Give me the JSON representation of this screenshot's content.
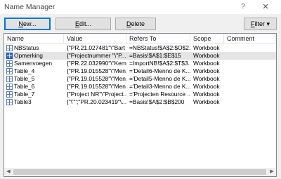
{
  "window": {
    "title": "Name Manager",
    "help_glyph": "?",
    "close_glyph": "✕"
  },
  "toolbar": {
    "new": {
      "mnemonic": "N",
      "rest": "ew..."
    },
    "edit": {
      "mnemonic": "E",
      "rest": "dit..."
    },
    "delete": {
      "mnemonic": "D",
      "rest": "elete"
    },
    "filter": {
      "mnemonic": "F",
      "rest": "ilter",
      "arrow": "▾"
    }
  },
  "table": {
    "columns": {
      "name": "Name",
      "value": "Value",
      "refers_to": "Refers To",
      "scope": "Scope",
      "comment": "Comment"
    },
    "rows": [
      {
        "name": "NBStatus",
        "value": "{\"PR.21.027481\"\\\"Bart ...",
        "refers_to": "=NBStatus!$A$2:$O$2...",
        "scope": "Workbook",
        "comment": ""
      },
      {
        "name": "Opmerking",
        "value": "{\"Projectnummer \"\\\"P...",
        "refers_to": "=Basis!$A$1:$E$15",
        "scope": "Workbook",
        "comment": ""
      },
      {
        "name": "Samenvoegen",
        "value": "{\"PR.22.032990\"\\\"Kem...",
        "refers_to": "=ImportNB!$A$2:$T$3...",
        "scope": "Workbook",
        "comment": ""
      },
      {
        "name": "Table_4",
        "value": "{\"PR.19.015528\"\\\"Men...",
        "refers_to": "='Detail6-Menno de K...",
        "scope": "Workbook",
        "comment": ""
      },
      {
        "name": "Table_5",
        "value": "{\"PR.19.015528\"\\\"Men...",
        "refers_to": "='Detail5-Menno de K...",
        "scope": "Workbook",
        "comment": ""
      },
      {
        "name": "Table_6",
        "value": "{\"PR.19.015528\"\\\"Men...",
        "refers_to": "='Detail3-Menno de K...",
        "scope": "Workbook",
        "comment": ""
      },
      {
        "name": "Table_7",
        "value": "{\"Project NR\"\\\"Project...",
        "refers_to": "='Projecten Resource ...",
        "scope": "Workbook",
        "comment": ""
      },
      {
        "name": "Table3",
        "value": "{\"\\\"\";\"PR.20.023419\"\\...",
        "refers_to": "=Basis!$A$2:$B$200",
        "scope": "Workbook",
        "comment": ""
      }
    ],
    "selected_index": 1
  },
  "scrollbar": {
    "left_arrow": "◀",
    "right_arrow": "▶"
  }
}
